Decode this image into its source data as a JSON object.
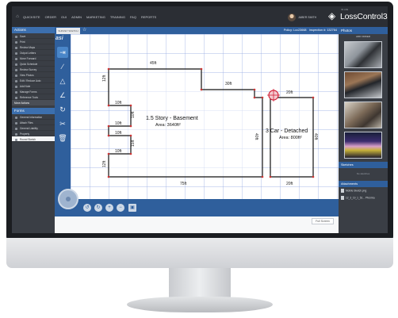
{
  "nav": {
    "items": [
      "QUICKSITE",
      "ORDER",
      "GUI",
      "ADMIN",
      "MARKETING",
      "TRAINING",
      "FAQ",
      "REPORTS"
    ],
    "user": "JABER SMITH"
  },
  "brand": {
    "tag": "ISI LIVE",
    "name": "LossControl360"
  },
  "sidebar": {
    "actions_title": "Actions",
    "actions": [
      "Save",
      "Print",
      "Review Maps",
      "Output Letters",
      "Move Forward",
      "Quick Schedule",
      "Review Survey",
      "View Photos",
      "Edit / Reduce Auto",
      "Add Note",
      "Manage Forms",
      "Reference Tools"
    ],
    "submenu_label": "Move Actions",
    "forms_title": "Forms",
    "forms": [
      "General Information",
      "Attach Files",
      "General Liability",
      "Property",
      "Round Sketch"
    ]
  },
  "header": {
    "tab_label": "SURVEY SKETCH",
    "policy_text": "Policy: Lcc23668",
    "inspection_text": "Inspection #: 132764"
  },
  "sketch": {
    "room1_name": "1.5 Story - Basement",
    "room1_area": "Area: 3640ft²",
    "room2_name": "3 Car - Detached",
    "room2_area": "Area: 800ft²",
    "dims": {
      "top_main": "45ft",
      "top_step": "30ft",
      "top_garage": "20ft",
      "bottom_main": "75ft",
      "bottom_garage": "20ft",
      "right_main": "40ft",
      "right_garage": "40ft",
      "left_top": "12ft",
      "left_bottom": "12ft",
      "notch1_w": "10ft",
      "notch1_h": "10ft",
      "notch1_b": "10ft",
      "notch2_w": "10ft",
      "notch2_h": "15ft",
      "notch2_b": "10ft"
    }
  },
  "footer": {
    "full_screen_label": "Full Screen"
  },
  "right_panel": {
    "photos_title": "Photos",
    "photo_actions": "ADD   ORDER",
    "sketches_title": "Sketches",
    "sketches_empty": "No sketches",
    "attachments_title": "Attachments",
    "attachments": [
      "Mobile Sketch.png",
      "12_3_19_1_52... PM.mka"
    ]
  }
}
